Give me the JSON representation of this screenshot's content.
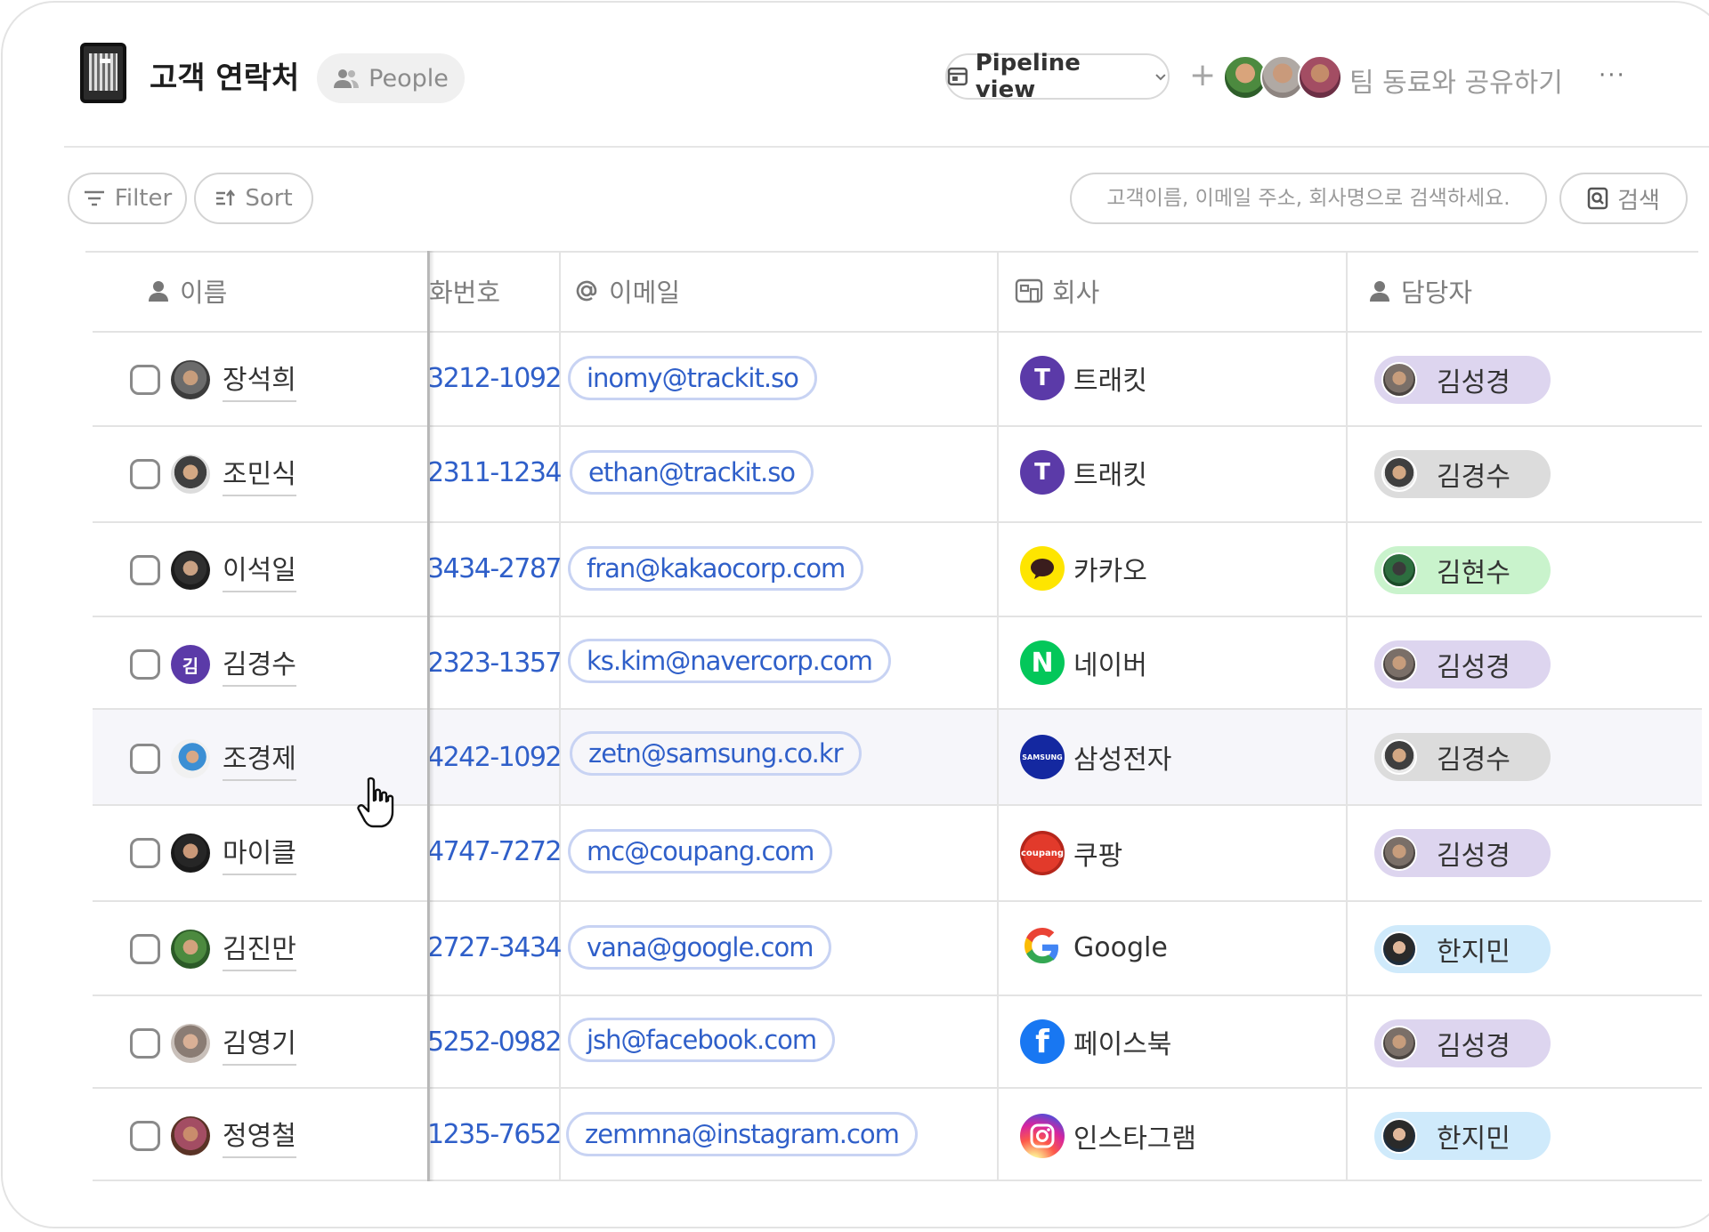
{
  "header": {
    "title": "고객 연락처",
    "people_chip": "People",
    "view_button": "Pipeline view",
    "share_text": "팀 동료와 공유하기",
    "more": "···"
  },
  "toolbar": {
    "filter": "Filter",
    "sort": "Sort",
    "search_placeholder": "고객이름, 이메일 주소, 회사명으로 검색하세요.",
    "search_button": "검색"
  },
  "columns": {
    "name": "이름",
    "phone": "화번호",
    "email": "이메일",
    "company": "회사",
    "owner": "담당자"
  },
  "rows": [
    {
      "name": "장석희",
      "phone": "3212-1092",
      "email": "inomy@trackit.so",
      "company": "트래킷",
      "owner": "김성경"
    },
    {
      "name": "조민식",
      "phone": "2311-1234",
      "email": "ethan@trackit.so",
      "company": "트래킷",
      "owner": "김경수"
    },
    {
      "name": "이석일",
      "phone": "3434-2787",
      "email": "fran@kakaocorp.com",
      "company": "카카오",
      "owner": "김현수"
    },
    {
      "name": "김경수",
      "avatar_initial": "김",
      "phone": "2323-1357",
      "email": "ks.kim@navercorp.com",
      "company": "네이버",
      "owner": "김성경"
    },
    {
      "name": "조경제",
      "phone": "4242-1092",
      "email": "zetn@samsung.co.kr",
      "company": "삼성전자",
      "owner": "김경수"
    },
    {
      "name": "마이클",
      "phone": "4747-7272",
      "email": "mc@coupang.com",
      "company": "쿠팡",
      "owner": "김성경"
    },
    {
      "name": "김진만",
      "phone": "2727-3434",
      "email": "vana@google.com",
      "company": "Google",
      "owner": "한지민"
    },
    {
      "name": "김영기",
      "phone": "5252-0982",
      "email": "jsh@facebook.com",
      "company": "페이스북",
      "owner": "김성경"
    },
    {
      "name": "정영철",
      "phone": "1235-7652",
      "email": "zemmna@instagram.com",
      "company": "인스타그램",
      "owner": "한지민"
    }
  ],
  "logos": {
    "trackit": "T",
    "naver": "N",
    "samsung": "SAMSUNG",
    "coupang": "coupang",
    "google": "G",
    "facebook": "f"
  },
  "colors": {
    "link_blue": "#2f5fc9",
    "owner_purple": "#ddd5ef",
    "owner_gray": "#dcdcdc",
    "owner_green": "#c9f3cc",
    "owner_blue": "#cfeafb",
    "trackit": "#5b3aa8",
    "kakao": "#fee500",
    "naver": "#03c75a",
    "samsung": "#1428a0",
    "facebook": "#1877f2"
  }
}
